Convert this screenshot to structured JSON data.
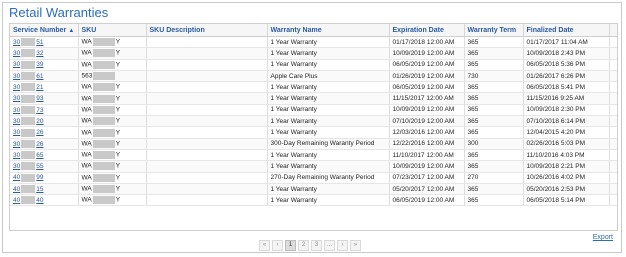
{
  "title": "Retail Warranties",
  "columns": [
    "Service Number",
    "SKU",
    "SKU Description",
    "Warranty Name",
    "Expiration Date",
    "Warranty Term",
    "Finalized Date"
  ],
  "rows": [
    {
      "sn_prefix": "30",
      "sn_suffix": "51",
      "sku_prefix": "WA",
      "sku_suffix": "Y",
      "desc": "",
      "warranty": "1 Year Warranty",
      "expiration": "01/17/2018 12:00 AM",
      "term": "365",
      "finalized": "01/17/2017 11:04 AM"
    },
    {
      "sn_prefix": "30",
      "sn_suffix": "32",
      "sku_prefix": "WA",
      "sku_suffix": "Y",
      "desc": "",
      "warranty": "1 Year Warranty",
      "expiration": "10/09/2019 12:00 AM",
      "term": "365",
      "finalized": "10/09/2018 2:43 PM"
    },
    {
      "sn_prefix": "30",
      "sn_suffix": "39",
      "sku_prefix": "WA",
      "sku_suffix": "Y",
      "desc": "",
      "warranty": "1 Year Warranty",
      "expiration": "06/05/2019 12:00 AM",
      "term": "365",
      "finalized": "06/05/2018 5:36 PM"
    },
    {
      "sn_prefix": "30",
      "sn_suffix": "61",
      "sku_prefix": "563",
      "sku_suffix": "",
      "desc": "",
      "warranty": "Apple Care Plus",
      "expiration": "01/26/2019 12:00 AM",
      "term": "730",
      "finalized": "01/26/2017 6:26 PM"
    },
    {
      "sn_prefix": "30",
      "sn_suffix": "21",
      "sku_prefix": "WA",
      "sku_suffix": "Y",
      "desc": "",
      "warranty": "1 Year Warranty",
      "expiration": "06/05/2019 12:00 AM",
      "term": "365",
      "finalized": "06/05/2018 5:41 PM"
    },
    {
      "sn_prefix": "30",
      "sn_suffix": "93",
      "sku_prefix": "WA",
      "sku_suffix": "Y",
      "desc": "",
      "warranty": "1 Year Warranty",
      "expiration": "11/15/2017 12:00 AM",
      "term": "365",
      "finalized": "11/15/2016 9:25 AM"
    },
    {
      "sn_prefix": "30",
      "sn_suffix": "73",
      "sku_prefix": "WA",
      "sku_suffix": "Y",
      "desc": "",
      "warranty": "1 Year Warranty",
      "expiration": "10/09/2019 12:00 AM",
      "term": "365",
      "finalized": "10/09/2018 2:30 PM"
    },
    {
      "sn_prefix": "30",
      "sn_suffix": "20",
      "sku_prefix": "WA",
      "sku_suffix": "Y",
      "desc": "",
      "warranty": "1 Year Warranty",
      "expiration": "07/10/2019 12:00 AM",
      "term": "365",
      "finalized": "07/10/2018 6:14 PM"
    },
    {
      "sn_prefix": "30",
      "sn_suffix": "26",
      "sku_prefix": "WA",
      "sku_suffix": "Y",
      "desc": "",
      "warranty": "1 Year Warranty",
      "expiration": "12/03/2016 12:00 AM",
      "term": "365",
      "finalized": "12/04/2015 4:20 PM"
    },
    {
      "sn_prefix": "30",
      "sn_suffix": "26",
      "sku_prefix": "WA",
      "sku_suffix": "Y",
      "desc": "",
      "warranty": "300-Day Remaining Waranty Period",
      "expiration": "12/22/2016 12:00 AM",
      "term": "300",
      "finalized": "02/26/2016 5:03 PM"
    },
    {
      "sn_prefix": "30",
      "sn_suffix": "65",
      "sku_prefix": "WA",
      "sku_suffix": "Y",
      "desc": "",
      "warranty": "1 Year Warranty",
      "expiration": "11/10/2017 12:00 AM",
      "term": "365",
      "finalized": "11/10/2016 4:03 PM"
    },
    {
      "sn_prefix": "30",
      "sn_suffix": "55",
      "sku_prefix": "WA",
      "sku_suffix": "Y",
      "desc": "",
      "warranty": "1 Year Warranty",
      "expiration": "10/09/2019 12:00 AM",
      "term": "365",
      "finalized": "10/09/2018 2:21 PM"
    },
    {
      "sn_prefix": "40",
      "sn_suffix": "99",
      "sku_prefix": "WA",
      "sku_suffix": "Y",
      "desc": "",
      "warranty": "270-Day Remaining Waranty Period",
      "expiration": "07/23/2017 12:00 AM",
      "term": "270",
      "finalized": "10/26/2016 4:02 PM"
    },
    {
      "sn_prefix": "40",
      "sn_suffix": "15",
      "sku_prefix": "WA",
      "sku_suffix": "Y",
      "desc": "",
      "warranty": "1 Year Warranty",
      "expiration": "05/20/2017 12:00 AM",
      "term": "365",
      "finalized": "05/20/2016 2:53 PM"
    },
    {
      "sn_prefix": "40",
      "sn_suffix": "40",
      "sku_prefix": "WA",
      "sku_suffix": "Y",
      "desc": "",
      "warranty": "1 Year Warranty",
      "expiration": "06/05/2019 12:00 AM",
      "term": "365",
      "finalized": "06/05/2018 5:14 PM"
    }
  ],
  "pager": {
    "first": "«",
    "prev": "‹",
    "pages": [
      "1",
      "2",
      "3",
      "..."
    ],
    "current_page": 1,
    "next": "›",
    "last": "»"
  },
  "export_label": "Export",
  "icons": {
    "sort": "sort-ascending-icon"
  },
  "colors": {
    "accent": "#2a6ebb",
    "header_text": "#2a5aa0"
  }
}
